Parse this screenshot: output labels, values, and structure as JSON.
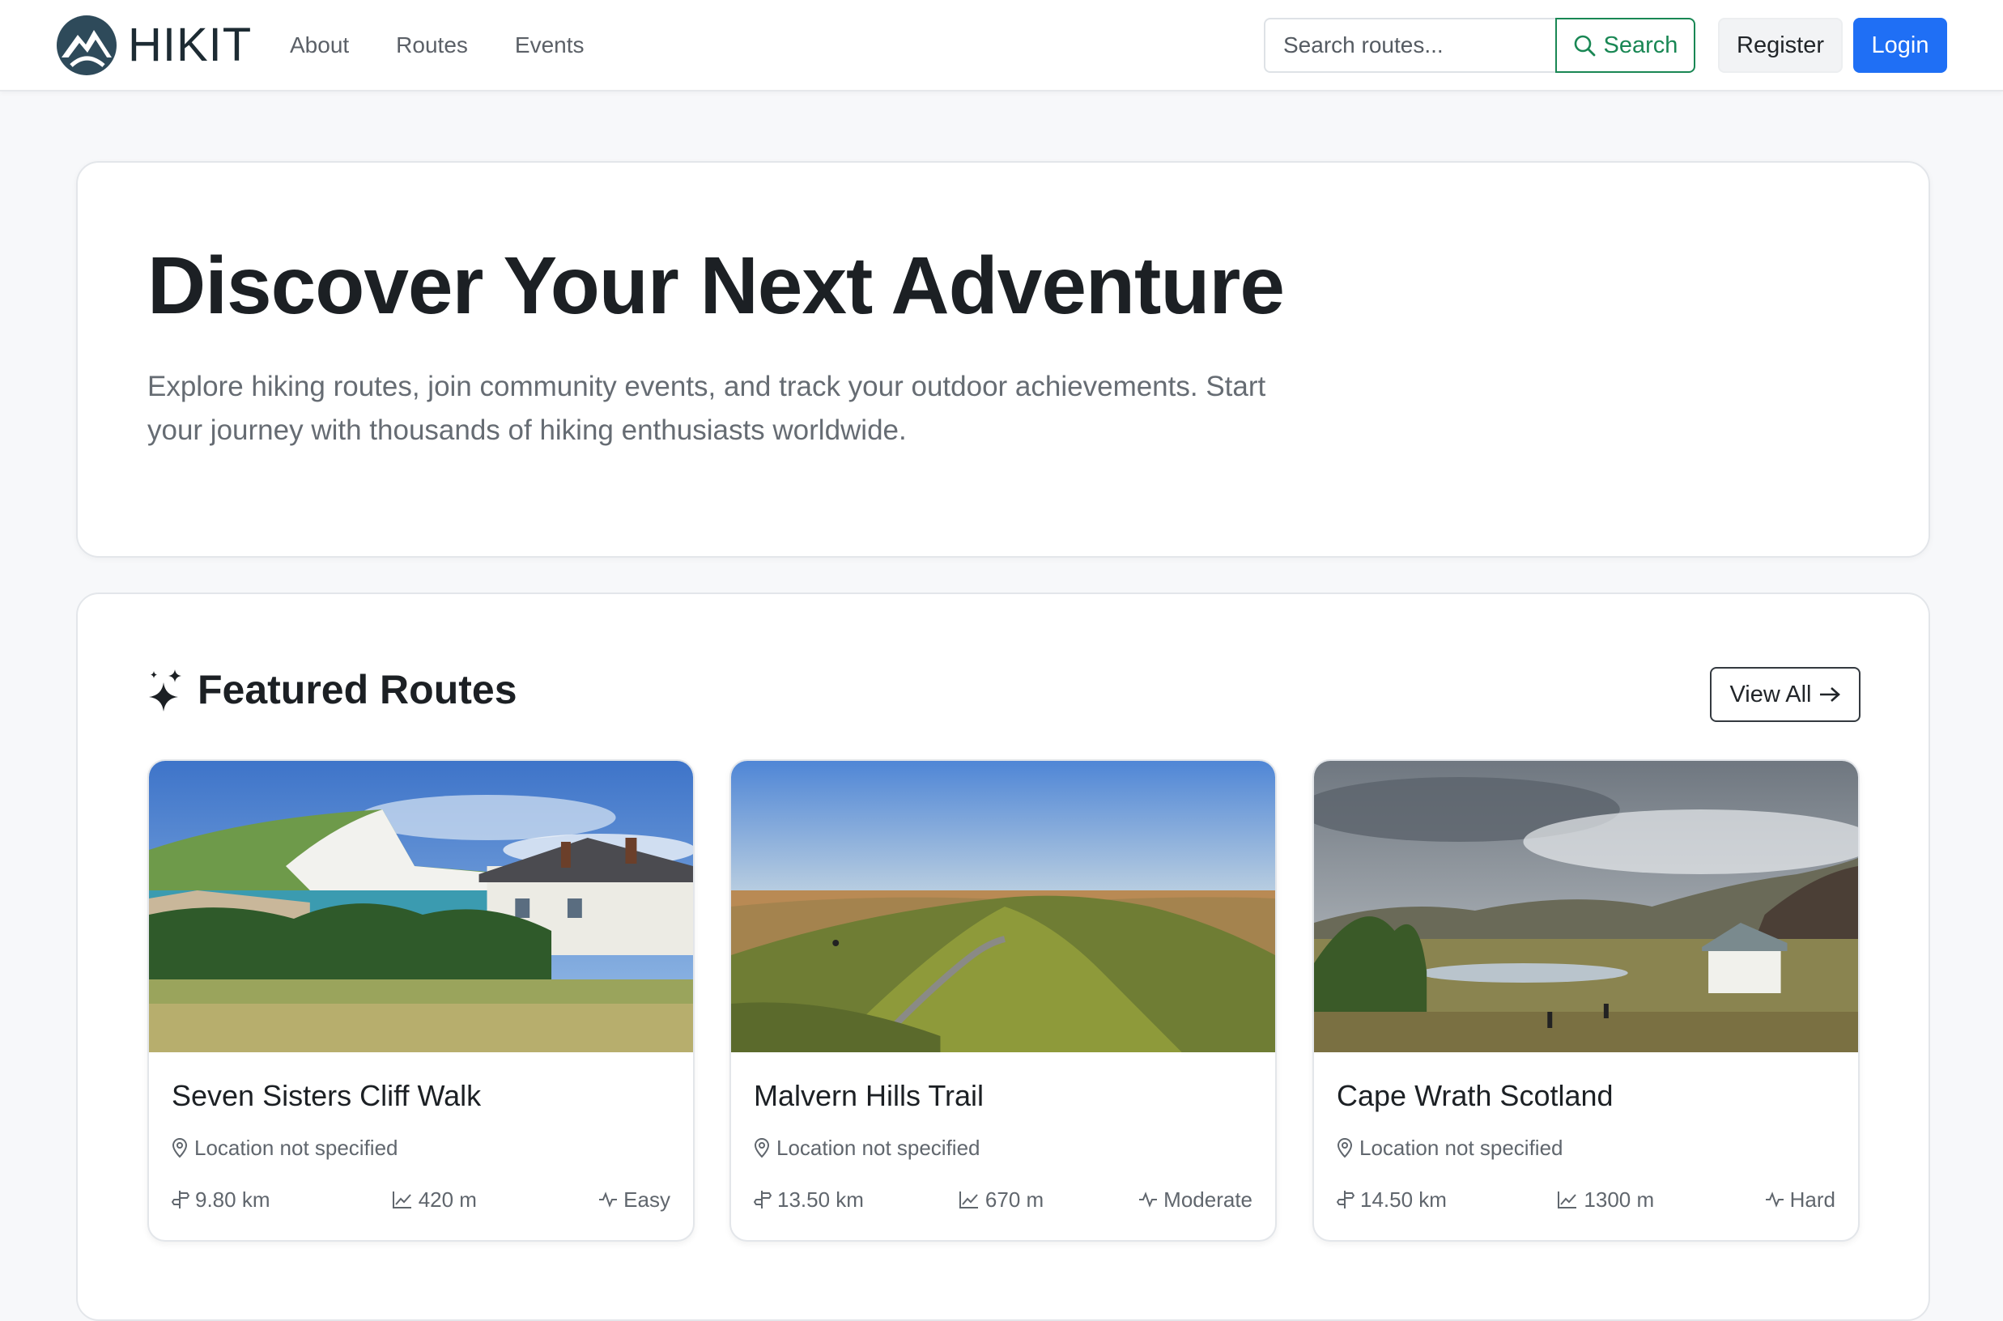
{
  "brand": {
    "name": "HIKIT"
  },
  "nav": {
    "links": [
      "About",
      "Routes",
      "Events"
    ]
  },
  "search": {
    "placeholder": "Search routes...",
    "button_label": "Search"
  },
  "auth": {
    "register_label": "Register",
    "login_label": "Login"
  },
  "hero": {
    "title": "Discover Your Next Adventure",
    "text": "Explore hiking routes, join community events, and track your outdoor achievements. Start your journey with thousands of hiking enthusiasts worldwide."
  },
  "featured": {
    "title": "Featured Routes",
    "view_all_label": "View All",
    "routes": [
      {
        "name": "Seven Sisters Cliff Walk",
        "location": "Location not specified",
        "distance": "9.80 km",
        "elevation": "420 m",
        "difficulty": "Easy"
      },
      {
        "name": "Malvern Hills Trail",
        "location": "Location not specified",
        "distance": "13.50 km",
        "elevation": "670 m",
        "difficulty": "Moderate"
      },
      {
        "name": "Cape Wrath Scotland",
        "location": "Location not specified",
        "distance": "14.50 km",
        "elevation": "1300 m",
        "difficulty": "Hard"
      }
    ]
  },
  "colors": {
    "primary": "#1f6ff5",
    "success": "#198754",
    "brand_dark": "#2e4a5a"
  },
  "icons": {
    "search": "search-icon",
    "sparkle": "sparkles-icon",
    "arrow": "arrow-right-icon",
    "location": "map-pin-icon",
    "distance": "signpost-icon",
    "elevation": "chart-line-icon",
    "difficulty": "activity-icon"
  }
}
